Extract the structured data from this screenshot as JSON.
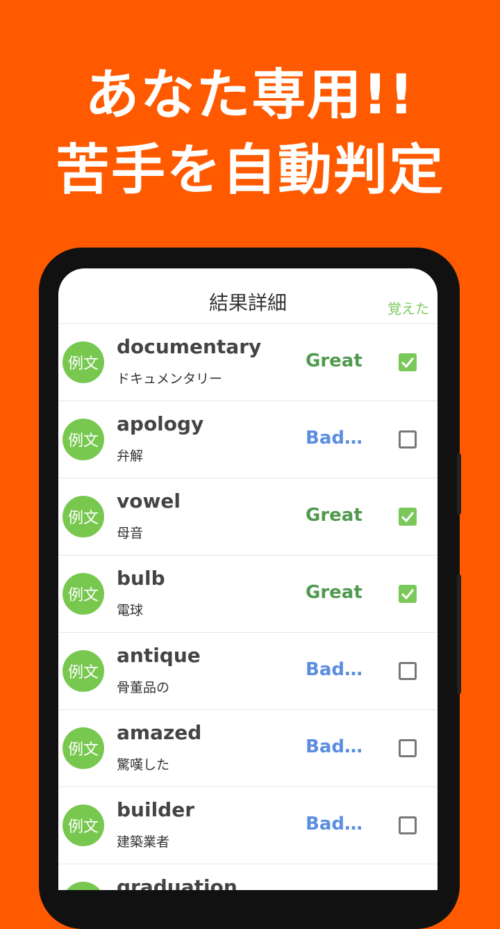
{
  "promo": {
    "line1": "あなた専用!!",
    "line2": "苦手を自動判定"
  },
  "header": {
    "title": "結果詳細",
    "learned_label": "覚えた"
  },
  "example_label": "例文",
  "items": [
    {
      "word": "documentary",
      "meaning": "ドキュメンタリー",
      "result": "Great!",
      "learned": true
    },
    {
      "word": "apology",
      "meaning": "弁解",
      "result": "Bad…",
      "learned": false
    },
    {
      "word": "vowel",
      "meaning": "母音",
      "result": "Great!",
      "learned": true
    },
    {
      "word": "bulb",
      "meaning": "電球",
      "result": "Great!",
      "learned": true
    },
    {
      "word": "antique",
      "meaning": "骨董品の",
      "result": "Bad…",
      "learned": false
    },
    {
      "word": "amazed",
      "meaning": "驚嘆した",
      "result": "Bad…",
      "learned": false
    },
    {
      "word": "builder",
      "meaning": "建築業者",
      "result": "Bad…",
      "learned": false
    },
    {
      "word": "graduation",
      "meaning": "",
      "result": "",
      "learned": false
    }
  ],
  "colors": {
    "background": "#ff5a00",
    "example_button": "#78c850",
    "great": "#4f9a4f",
    "bad": "#5b8de0",
    "checked": "#7ac85a"
  }
}
